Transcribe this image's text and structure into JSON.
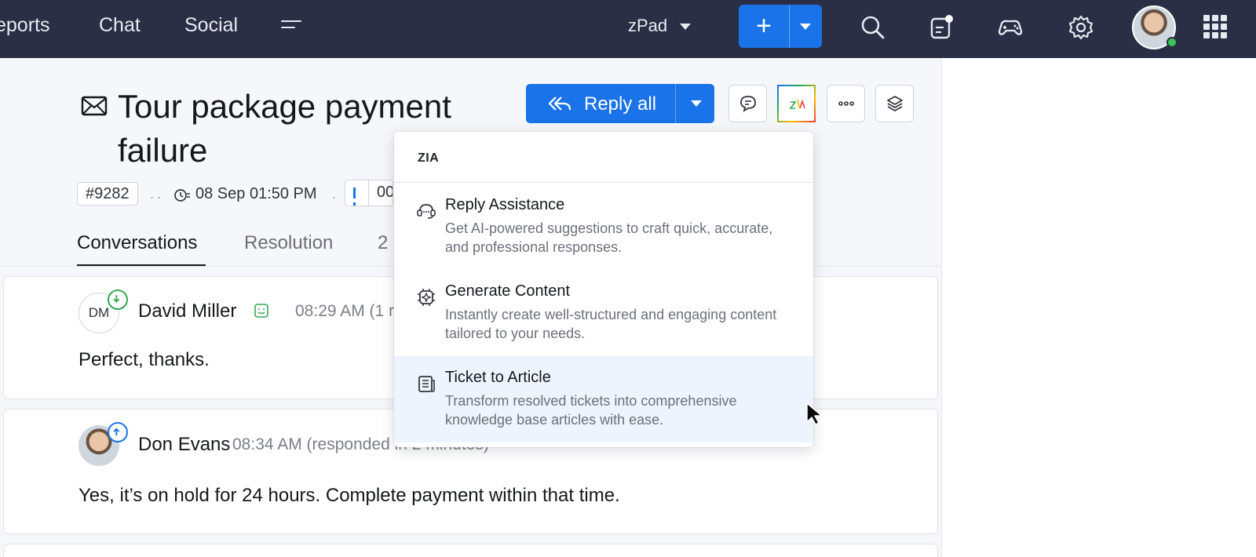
{
  "nav": {
    "reports": "eports",
    "chat": "Chat",
    "social": "Social",
    "workspace": "zPad"
  },
  "ticket": {
    "title": "Tour package payment failure",
    "id": "#9282",
    "due": "08 Sep 01:50 PM",
    "timer": "00"
  },
  "toolbar": {
    "reply_label": "Reply all"
  },
  "tabs": {
    "conversations": "Conversations",
    "resolution": "Resolution",
    "third": "2"
  },
  "messages": [
    {
      "initials": "DM",
      "sender": "David Miller",
      "time": "08:29 AM (1 r",
      "body": "Perfect, thanks."
    },
    {
      "sender": "Don Evans",
      "time": "08:34 AM (responded in 2 minutes)",
      "body": "Yes, it’s on hold for 24 hours. Complete payment within that time."
    }
  ],
  "zia": {
    "header": "ZIA",
    "items": [
      {
        "title": "Reply Assistance",
        "desc": "Get AI-powered suggestions to craft quick, accurate, and professional responses.",
        "icon": "reply-assistance-icon"
      },
      {
        "title": "Generate Content",
        "desc": "Instantly create well-structured and engaging content tailored to your needs.",
        "icon": "generate-content-icon"
      },
      {
        "title": "Ticket to Article",
        "desc": "Transform resolved tickets into comprehensive knowledge base articles with ease.",
        "icon": "ticket-to-article-icon"
      }
    ]
  },
  "colors": {
    "topbar": "#2b2f45",
    "accent": "#1a73e8",
    "highlight": "#eef4fd",
    "online": "#34c759"
  }
}
